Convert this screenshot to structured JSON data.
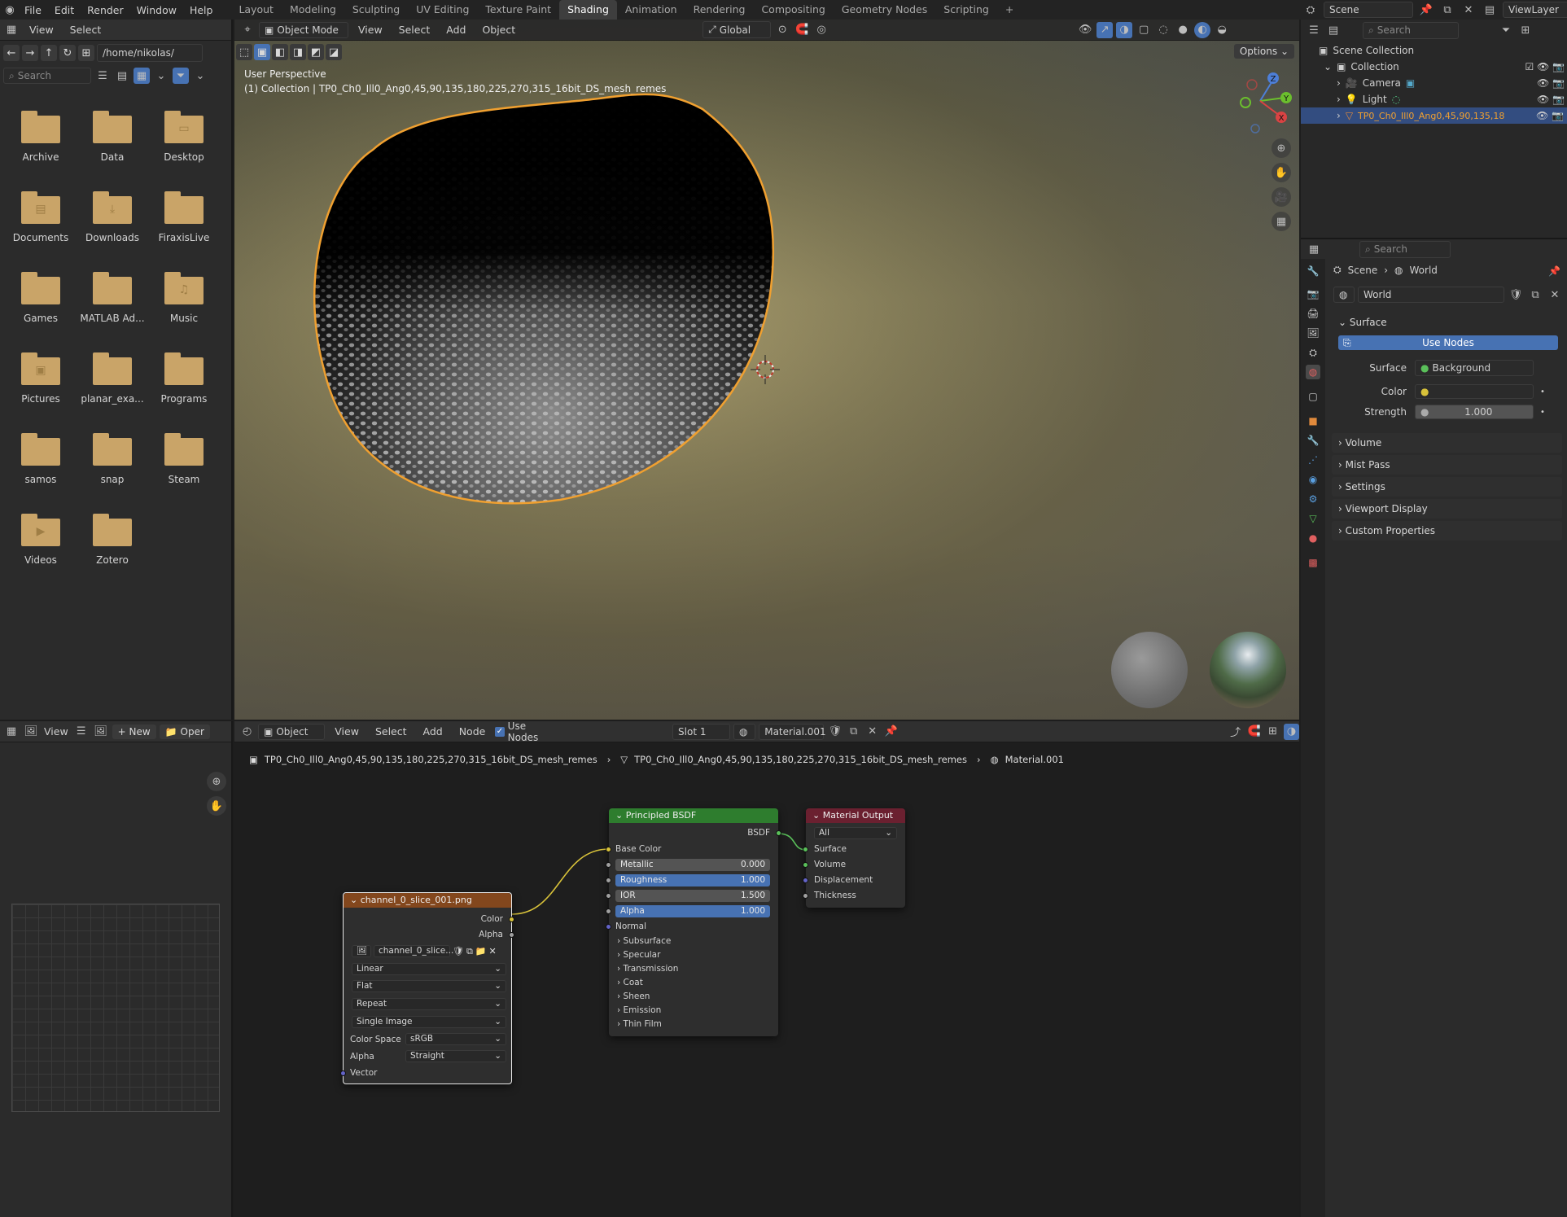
{
  "topbar": {
    "menus": [
      "File",
      "Edit",
      "Render",
      "Window",
      "Help"
    ],
    "workspaces": [
      "Layout",
      "Modeling",
      "Sculpting",
      "UV Editing",
      "Texture Paint",
      "Shading",
      "Animation",
      "Rendering",
      "Compositing",
      "Geometry Nodes",
      "Scripting"
    ],
    "active_workspace": "Shading",
    "add_tab": "+",
    "scene_label": "Scene",
    "viewlayer_label": "ViewLayer"
  },
  "filebrowser": {
    "menus": [
      "View",
      "Select"
    ],
    "path": "/home/nikolas/",
    "search_placeholder": "Search",
    "folders": [
      "Archive",
      "Data",
      "Desktop",
      "Documents",
      "Downloads",
      "FiraxisLive",
      "Games",
      "MATLAB Ad...",
      "Music",
      "Pictures",
      "planar_exa...",
      "Programs",
      "samos",
      "snap",
      "Steam",
      "Videos",
      "Zotero"
    ]
  },
  "viewport": {
    "mode": "Object Mode",
    "menus": [
      "View",
      "Select",
      "Add",
      "Object"
    ],
    "orientation": "Global",
    "options_label": "Options",
    "perspective_label": "User Perspective",
    "collection_label": "(1) Collection | TP0_Ch0_Ill0_Ang0,45,90,135,180,225,270,315_16bit_DS_mesh_remes",
    "gizmo": {
      "z": "Z",
      "y": "Y",
      "x": "X"
    }
  },
  "outliner": {
    "search_placeholder": "Search",
    "scene_collection": "Scene Collection",
    "items": [
      {
        "label": "Collection"
      },
      {
        "label": "Camera"
      },
      {
        "label": "Light"
      },
      {
        "label": "TP0_Ch0_Ill0_Ang0,45,90,135,18"
      }
    ]
  },
  "properties": {
    "search_placeholder": "Search",
    "breadcrumb": {
      "scene": "Scene",
      "world": "World"
    },
    "world_name": "World",
    "surface_panel": "Surface",
    "use_nodes_label": "Use Nodes",
    "surface_label": "Surface",
    "surface_value": "Background",
    "color_label": "Color",
    "strength_label": "Strength",
    "strength_value": "1.000",
    "panels": [
      "Volume",
      "Mist Pass",
      "Settings",
      "Viewport Display",
      "Custom Properties"
    ]
  },
  "imageeditor": {
    "view_label": "View",
    "new_label": "New",
    "open_label": "Oper"
  },
  "nodeeditor": {
    "object_label": "Object",
    "menus": [
      "View",
      "Select",
      "Add",
      "Node"
    ],
    "use_nodes_label": "Use Nodes",
    "slot": "Slot 1",
    "material": "Material.001",
    "breadcrumb": [
      "TP0_Ch0_Ill0_Ang0,45,90,135,180,225,270,315_16bit_DS_mesh_remes",
      "TP0_Ch0_Ill0_Ang0,45,90,135,180,225,270,315_16bit_DS_mesh_remes",
      "Material.001"
    ],
    "image_node": {
      "title": "channel_0_slice_001.png",
      "out_color": "Color",
      "out_alpha": "Alpha",
      "image_name": "channel_0_slice...",
      "interpolation": "Linear",
      "projection": "Flat",
      "extension": "Repeat",
      "source": "Single Image",
      "color_space_label": "Color Space",
      "color_space": "sRGB",
      "alpha_label": "Alpha",
      "alpha_mode": "Straight",
      "vector": "Vector"
    },
    "bsdf_node": {
      "title": "Principled BSDF",
      "output": "BSDF",
      "base_color": "Base Color",
      "metallic_label": "Metallic",
      "metallic": "0.000",
      "roughness_label": "Roughness",
      "roughness": "1.000",
      "ior_label": "IOR",
      "ior": "1.500",
      "alpha_label": "Alpha",
      "alpha": "1.000",
      "normal": "Normal",
      "subpanels": [
        "Subsurface",
        "Specular",
        "Transmission",
        "Coat",
        "Sheen",
        "Emission",
        "Thin Film"
      ]
    },
    "output_node": {
      "title": "Material Output",
      "target": "All",
      "inputs": [
        "Surface",
        "Volume",
        "Displacement",
        "Thickness"
      ]
    }
  },
  "colors": {
    "accent": "#4772b3",
    "selection_outline": "#f0a030",
    "folder": "#c9a468",
    "image_node_header": "#83471d",
    "bsdf_node_header": "#2e7d2e",
    "output_node_header": "#6b2030"
  }
}
